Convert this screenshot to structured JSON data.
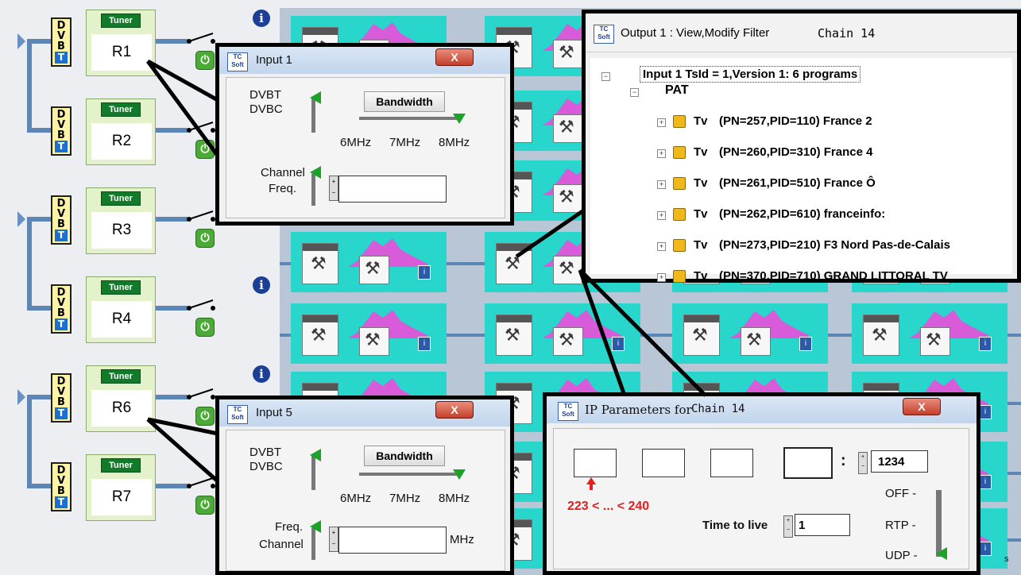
{
  "tuners": [
    {
      "dvb_letters": [
        "D",
        "V",
        "B"
      ],
      "dvb_badge": "T",
      "tag": "Tuner",
      "label": "R1"
    },
    {
      "dvb_letters": [
        "D",
        "V",
        "B"
      ],
      "dvb_badge": "T",
      "tag": "Tuner",
      "label": "R2"
    },
    {
      "dvb_letters": [
        "D",
        "V",
        "B"
      ],
      "dvb_badge": "T",
      "tag": "Tuner",
      "label": "R3"
    },
    {
      "dvb_letters": [
        "D",
        "V",
        "B"
      ],
      "dvb_badge": "T",
      "tag": "Tuner",
      "label": "R4"
    },
    {
      "dvb_letters": [
        "D",
        "V",
        "B"
      ],
      "dvb_badge": "T",
      "tag": "Tuner",
      "label": "R6"
    },
    {
      "dvb_letters": [
        "D",
        "V",
        "B"
      ],
      "dvb_badge": "T",
      "tag": "Tuner",
      "label": "R7"
    }
  ],
  "icons": {
    "power": "power-icon",
    "info": "info-icon",
    "tools": "tools-icon",
    "close": "close-icon",
    "lock": "lock-icon"
  },
  "colors": {
    "cell": "#28d6cc",
    "wave": "#d85bd9",
    "tuner_tag": "#127b2a",
    "power": "#4caa37",
    "info": "#1c3f96",
    "red_hint": "#e11f1f"
  },
  "symbols": {
    "info": "i",
    "power": "⏻",
    "close": "X",
    "tools": "⚒",
    "plus": "+",
    "minus": "−"
  },
  "input1": {
    "title": "Input 1",
    "mode_top": "DVBT",
    "mode_bottom": "DVBC",
    "bandwidth_label": "Bandwidth",
    "bw_6": "6MHz",
    "bw_7": "7MHz",
    "bw_8": "8MHz",
    "selected_bandwidth": "8MHz",
    "freq_top": "Channel",
    "freq_bottom": "Freq.",
    "freq_value": ""
  },
  "input5": {
    "title": "Input 5",
    "mode_top": "DVBT",
    "mode_bottom": "DVBC",
    "bandwidth_label": "Bandwidth",
    "bw_6": "6MHz",
    "bw_7": "7MHz",
    "bw_8": "8MHz",
    "selected_bandwidth": "8MHz",
    "freq_top": "Freq.",
    "freq_bottom": "Channel",
    "freq_value": "",
    "unit": "MHz"
  },
  "output": {
    "title": "Output 1 : View,Modify Filter",
    "chain": "Chain 14",
    "root": "Input 1  TsId = 1,Version 1: 6 programs",
    "pat": "PAT",
    "programs": [
      {
        "type": "Tv",
        "details": "(PN=257,PID=110) France 2"
      },
      {
        "type": "Tv",
        "details": "(PN=260,PID=310) France 4"
      },
      {
        "type": "Tv",
        "details": "(PN=261,PID=510) France Ô"
      },
      {
        "type": "Tv",
        "details": "(PN=262,PID=610) franceinfo:"
      },
      {
        "type": "Tv",
        "details": "(PN=273,PID=210) F3 Nord Pas-de-Calais"
      },
      {
        "type": "Tv",
        "details": "(PN=370,PID=710) GRAND LITTORAL TV"
      }
    ]
  },
  "ip": {
    "title": "IP Parameters for",
    "chain": "Chain 14",
    "octets": [
      "",
      "",
      "",
      ""
    ],
    "colon": ":",
    "port": "1234",
    "hint": "223 < ... < 240",
    "ttl_label": "Time to live",
    "ttl_value": "1",
    "mode_off": "OFF -",
    "mode_rtp": "RTP -",
    "mode_udp": "UDP -",
    "selected_mode": "UDP"
  },
  "bottom_right_text": "s"
}
